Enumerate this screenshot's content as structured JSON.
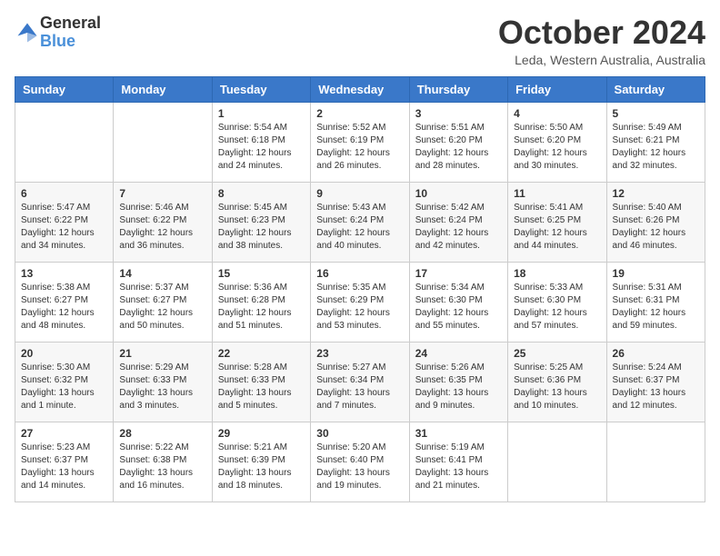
{
  "header": {
    "logo_general": "General",
    "logo_blue": "Blue",
    "month_title": "October 2024",
    "location": "Leda, Western Australia, Australia"
  },
  "weekdays": [
    "Sunday",
    "Monday",
    "Tuesday",
    "Wednesday",
    "Thursday",
    "Friday",
    "Saturday"
  ],
  "weeks": [
    [
      {
        "day": "",
        "info": ""
      },
      {
        "day": "",
        "info": ""
      },
      {
        "day": "1",
        "info": "Sunrise: 5:54 AM\nSunset: 6:18 PM\nDaylight: 12 hours\nand 24 minutes."
      },
      {
        "day": "2",
        "info": "Sunrise: 5:52 AM\nSunset: 6:19 PM\nDaylight: 12 hours\nand 26 minutes."
      },
      {
        "day": "3",
        "info": "Sunrise: 5:51 AM\nSunset: 6:20 PM\nDaylight: 12 hours\nand 28 minutes."
      },
      {
        "day": "4",
        "info": "Sunrise: 5:50 AM\nSunset: 6:20 PM\nDaylight: 12 hours\nand 30 minutes."
      },
      {
        "day": "5",
        "info": "Sunrise: 5:49 AM\nSunset: 6:21 PM\nDaylight: 12 hours\nand 32 minutes."
      }
    ],
    [
      {
        "day": "6",
        "info": "Sunrise: 5:47 AM\nSunset: 6:22 PM\nDaylight: 12 hours\nand 34 minutes."
      },
      {
        "day": "7",
        "info": "Sunrise: 5:46 AM\nSunset: 6:22 PM\nDaylight: 12 hours\nand 36 minutes."
      },
      {
        "day": "8",
        "info": "Sunrise: 5:45 AM\nSunset: 6:23 PM\nDaylight: 12 hours\nand 38 minutes."
      },
      {
        "day": "9",
        "info": "Sunrise: 5:43 AM\nSunset: 6:24 PM\nDaylight: 12 hours\nand 40 minutes."
      },
      {
        "day": "10",
        "info": "Sunrise: 5:42 AM\nSunset: 6:24 PM\nDaylight: 12 hours\nand 42 minutes."
      },
      {
        "day": "11",
        "info": "Sunrise: 5:41 AM\nSunset: 6:25 PM\nDaylight: 12 hours\nand 44 minutes."
      },
      {
        "day": "12",
        "info": "Sunrise: 5:40 AM\nSunset: 6:26 PM\nDaylight: 12 hours\nand 46 minutes."
      }
    ],
    [
      {
        "day": "13",
        "info": "Sunrise: 5:38 AM\nSunset: 6:27 PM\nDaylight: 12 hours\nand 48 minutes."
      },
      {
        "day": "14",
        "info": "Sunrise: 5:37 AM\nSunset: 6:27 PM\nDaylight: 12 hours\nand 50 minutes."
      },
      {
        "day": "15",
        "info": "Sunrise: 5:36 AM\nSunset: 6:28 PM\nDaylight: 12 hours\nand 51 minutes."
      },
      {
        "day": "16",
        "info": "Sunrise: 5:35 AM\nSunset: 6:29 PM\nDaylight: 12 hours\nand 53 minutes."
      },
      {
        "day": "17",
        "info": "Sunrise: 5:34 AM\nSunset: 6:30 PM\nDaylight: 12 hours\nand 55 minutes."
      },
      {
        "day": "18",
        "info": "Sunrise: 5:33 AM\nSunset: 6:30 PM\nDaylight: 12 hours\nand 57 minutes."
      },
      {
        "day": "19",
        "info": "Sunrise: 5:31 AM\nSunset: 6:31 PM\nDaylight: 12 hours\nand 59 minutes."
      }
    ],
    [
      {
        "day": "20",
        "info": "Sunrise: 5:30 AM\nSunset: 6:32 PM\nDaylight: 13 hours\nand 1 minute."
      },
      {
        "day": "21",
        "info": "Sunrise: 5:29 AM\nSunset: 6:33 PM\nDaylight: 13 hours\nand 3 minutes."
      },
      {
        "day": "22",
        "info": "Sunrise: 5:28 AM\nSunset: 6:33 PM\nDaylight: 13 hours\nand 5 minutes."
      },
      {
        "day": "23",
        "info": "Sunrise: 5:27 AM\nSunset: 6:34 PM\nDaylight: 13 hours\nand 7 minutes."
      },
      {
        "day": "24",
        "info": "Sunrise: 5:26 AM\nSunset: 6:35 PM\nDaylight: 13 hours\nand 9 minutes."
      },
      {
        "day": "25",
        "info": "Sunrise: 5:25 AM\nSunset: 6:36 PM\nDaylight: 13 hours\nand 10 minutes."
      },
      {
        "day": "26",
        "info": "Sunrise: 5:24 AM\nSunset: 6:37 PM\nDaylight: 13 hours\nand 12 minutes."
      }
    ],
    [
      {
        "day": "27",
        "info": "Sunrise: 5:23 AM\nSunset: 6:37 PM\nDaylight: 13 hours\nand 14 minutes."
      },
      {
        "day": "28",
        "info": "Sunrise: 5:22 AM\nSunset: 6:38 PM\nDaylight: 13 hours\nand 16 minutes."
      },
      {
        "day": "29",
        "info": "Sunrise: 5:21 AM\nSunset: 6:39 PM\nDaylight: 13 hours\nand 18 minutes."
      },
      {
        "day": "30",
        "info": "Sunrise: 5:20 AM\nSunset: 6:40 PM\nDaylight: 13 hours\nand 19 minutes."
      },
      {
        "day": "31",
        "info": "Sunrise: 5:19 AM\nSunset: 6:41 PM\nDaylight: 13 hours\nand 21 minutes."
      },
      {
        "day": "",
        "info": ""
      },
      {
        "day": "",
        "info": ""
      }
    ]
  ]
}
